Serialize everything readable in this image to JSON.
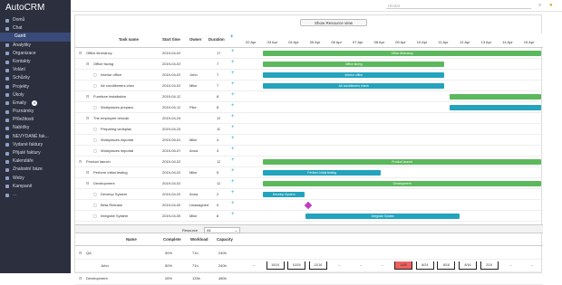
{
  "app": {
    "title": "AutoCRM"
  },
  "sidebar": {
    "items": [
      {
        "label": "Domů"
      },
      {
        "label": "Chat"
      },
      {
        "label": "Gantt"
      },
      {
        "label": "Analytiky"
      },
      {
        "label": "Organizace"
      },
      {
        "label": "Kontakty"
      },
      {
        "label": "Volání"
      },
      {
        "label": "Schůzky"
      },
      {
        "label": "Projekty"
      },
      {
        "label": "Úkoly"
      },
      {
        "label": "Emaily",
        "badge": "4"
      },
      {
        "label": "Poznámky"
      },
      {
        "label": "Příležitosti"
      },
      {
        "label": "Nabídky"
      },
      {
        "label": "NEVYDANÉ fak..."
      },
      {
        "label": "Vydané faktury"
      },
      {
        "label": "Přijaté faktury"
      },
      {
        "label": "Kalendáře"
      },
      {
        "label": "Znalostní báze"
      },
      {
        "label": "Weby"
      },
      {
        "label": "Kampaně"
      },
      {
        "label": "..."
      }
    ]
  },
  "topbar": {
    "search_placeholder": "Hledat"
  },
  "gantt": {
    "show_resource_label": "Show Resource view",
    "collapse_marker": "z",
    "columns": [
      "Task name",
      "Start time",
      "Owner",
      "Duration"
    ],
    "dates": [
      "02 Apr",
      "03 Apr",
      "04 Apr",
      "05 Apr",
      "06 Apr",
      "07 Apr",
      "08 Apr",
      "09 Apr",
      "10 Apr",
      "11 Apr",
      "12 Apr",
      "13 Apr",
      "14 Apr",
      "15 Apr"
    ],
    "tasks": [
      {
        "name": "Office itinerancy",
        "start": "2019-04-03",
        "owner": "",
        "duration": "17",
        "indent": 0,
        "bar_label": "Office itinerancy"
      },
      {
        "name": "Office facing",
        "start": "2019-04-03",
        "owner": "",
        "duration": "7",
        "indent": 1,
        "bar_label": "Office facing"
      },
      {
        "name": "Interior office",
        "start": "2019-04-03",
        "owner": "John",
        "duration": "7",
        "indent": 2,
        "bar_label": "Interior office"
      },
      {
        "name": "Air conditioners chec",
        "start": "2019-04-03",
        "owner": "Mike",
        "duration": "7",
        "indent": 2,
        "bar_label": "Air conditioners check"
      },
      {
        "name": "Furniture installation",
        "start": "2019-04-12",
        "owner": "",
        "duration": "8",
        "indent": 1,
        "bar_label": ""
      },
      {
        "name": "Workplaces prepara",
        "start": "2019-04-12",
        "owner": "Pike",
        "duration": "8",
        "indent": 2,
        "bar_label": ""
      },
      {
        "name": "The employee relocati",
        "start": "2019-04-24",
        "owner": "",
        "duration": "13",
        "indent": 1,
        "bar_label": ""
      },
      {
        "name": "Preparing workplac",
        "start": "2019-04-24",
        "owner": "",
        "duration": "10",
        "indent": 2,
        "bar_label": ""
      },
      {
        "name": "Workplaces importat",
        "start": "2019-05-01",
        "owner": "Mike",
        "duration": "4",
        "indent": 2,
        "bar_label": ""
      },
      {
        "name": "Workplaces importat",
        "start": "2019-05-07",
        "owner": "Anna",
        "duration": "3",
        "indent": 2,
        "bar_label": ""
      },
      {
        "name": "Product launch",
        "start": "2019-04-03",
        "owner": "",
        "duration": "12",
        "indent": 0,
        "bar_label": "Product launch"
      },
      {
        "name": "Perform Initial testing",
        "start": "2019-04-03",
        "owner": "Mike",
        "duration": "5",
        "indent": 1,
        "bar_label": "Perform Initial testing"
      },
      {
        "name": "Development",
        "start": "2019-04-03",
        "owner": "",
        "duration": "12",
        "indent": 1,
        "bar_label": "Development"
      },
      {
        "name": "Develop System",
        "start": "2019-04-03",
        "owner": "Anna",
        "duration": "2",
        "indent": 2,
        "bar_label": "Develop System"
      },
      {
        "name": "Beta Release",
        "start": "2019-04-05",
        "owner": "Unassigned",
        "duration": "0",
        "indent": 2,
        "bar_label": ""
      },
      {
        "name": "Integrate System",
        "start": "2019-04-05",
        "owner": "Mike",
        "duration": "8",
        "indent": 2,
        "bar_label": "Integrate System"
      }
    ],
    "resource": {
      "label": "Resource",
      "selected": "All",
      "columns": [
        "Name",
        "Complete",
        "Workload",
        "Capacity"
      ],
      "rows": [
        {
          "name": "QA",
          "complete": "50%",
          "workload": "71h",
          "capacity": "240h",
          "cells": []
        },
        {
          "name": "John",
          "complete": "50%",
          "workload": "71h",
          "capacity": "240h",
          "cells": [
            "–",
            "10/24",
            "10/24",
            "12/16",
            "–",
            "–",
            "–",
            "16/8",
            "8/24",
            "8/16",
            "8/16",
            "2/24",
            "–",
            "–"
          ]
        },
        {
          "name": "Development",
          "complete": "26%",
          "workload": "133h",
          "capacity": "480h",
          "cells": []
        }
      ]
    }
  }
}
